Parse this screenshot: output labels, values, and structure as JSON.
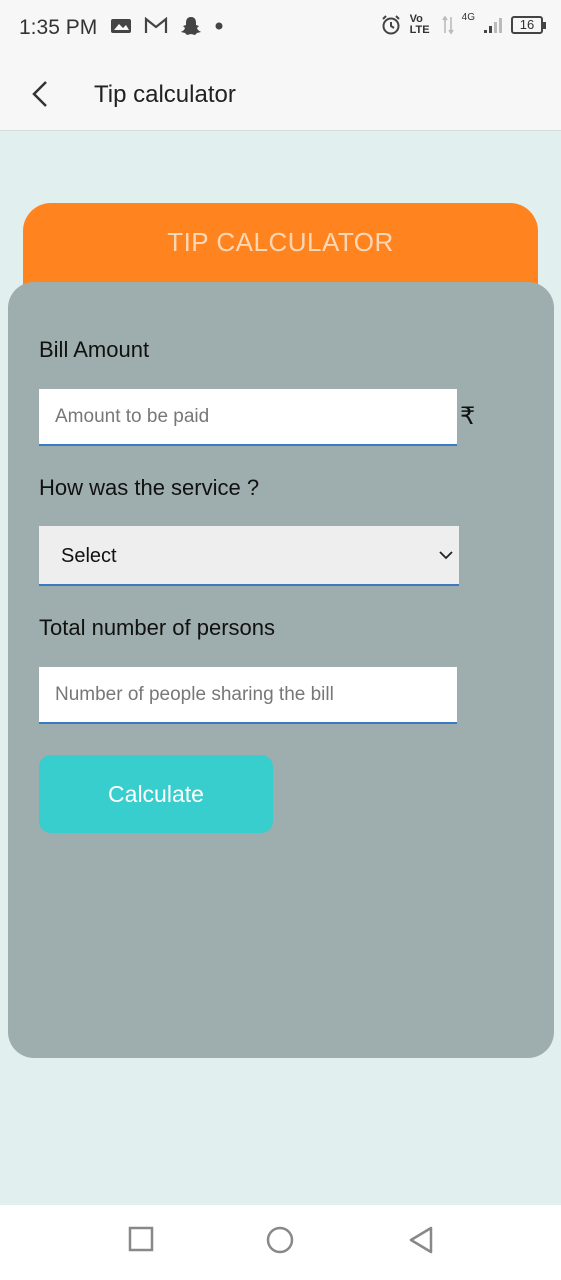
{
  "status_bar": {
    "time": "1:35 PM",
    "network_type": "4G",
    "volte": "Vo LTE",
    "battery": "16",
    "icons": [
      "gallery-icon",
      "gmail-icon",
      "snapchat-icon",
      "dot-icon",
      "alarm-icon",
      "signal-icon",
      "battery-icon"
    ]
  },
  "app_bar": {
    "title": "Tip calculator",
    "back_icon": "chevron-left-icon"
  },
  "card": {
    "header_title": "TIP CALCULATOR",
    "bill_label": "Bill Amount",
    "bill_placeholder": "Amount to be paid",
    "currency_symbol": "₹",
    "service_label": "How was the service ?",
    "service_selected": "Select",
    "persons_label": "Total number of persons",
    "persons_placeholder": "Number of people sharing the bill",
    "calculate_label": "Calculate"
  },
  "colors": {
    "header": "#ff841f",
    "card": "#9eadad",
    "background": "#e2efef",
    "button": "#38cecd"
  },
  "nav_bar": {
    "items": [
      "square-icon",
      "circle-icon",
      "triangle-back-icon"
    ]
  }
}
